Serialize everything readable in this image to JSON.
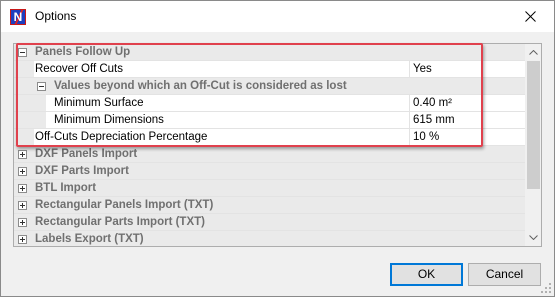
{
  "window": {
    "title": "Options",
    "app_icon_letter": "N",
    "close_icon": "close-icon"
  },
  "property_grid": {
    "categories": [
      {
        "label": "Panels Follow Up",
        "expanded": true
      },
      {
        "label": "DXF Panels Import",
        "expanded": false
      },
      {
        "label": "DXF Parts Import",
        "expanded": false
      },
      {
        "label": "BTL Import",
        "expanded": false
      },
      {
        "label": "Rectangular Panels Import (TXT)",
        "expanded": false
      },
      {
        "label": "Rectangular Parts Import (TXT)",
        "expanded": false
      },
      {
        "label": "Labels Export (TXT)",
        "expanded": false
      }
    ],
    "panels_follow_up": {
      "recover_off_cuts": {
        "name": "Recover Off Cuts",
        "value": "Yes"
      },
      "subcategory": {
        "label": "Values beyond which an Off-Cut is considered as lost",
        "expanded": true
      },
      "minimum_surface": {
        "name": "Minimum Surface",
        "value": "0.40 m²"
      },
      "minimum_dimensions": {
        "name": "Minimum Dimensions",
        "value": "615 mm"
      },
      "depreciation": {
        "name": "Off-Cuts Depreciation Percentage",
        "value": "10 %"
      }
    }
  },
  "buttons": {
    "ok": "OK",
    "cancel": "Cancel"
  },
  "colors": {
    "highlight_border": "#e0414d",
    "category_background": "#eaeaea",
    "category_text": "#707070",
    "default_button_border": "#0078d7"
  }
}
